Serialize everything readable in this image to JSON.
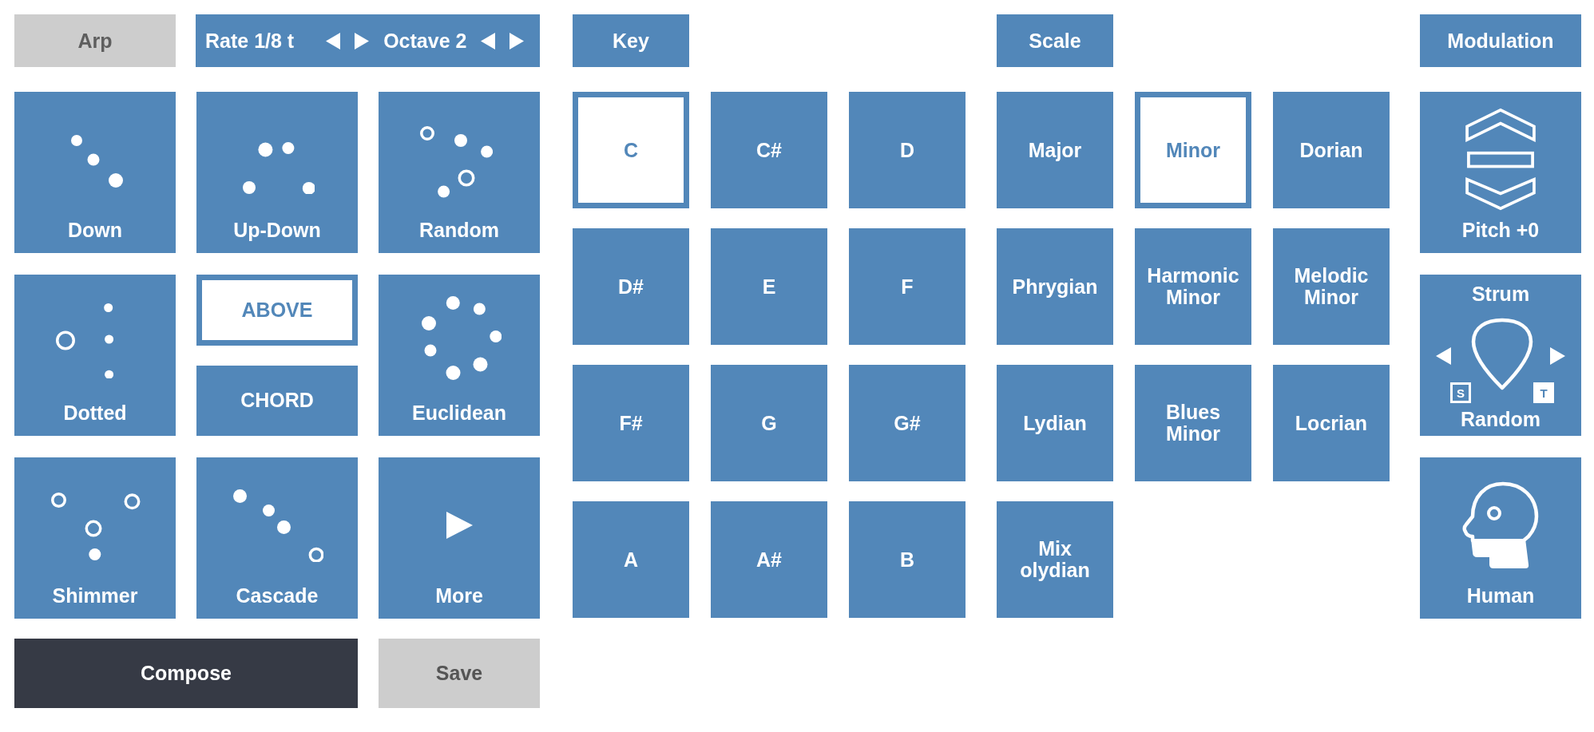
{
  "arp": {
    "toggle": {
      "label": "Arp",
      "on": false
    },
    "rate": {
      "label": "Rate 1/8 t"
    },
    "octave": {
      "label": "Octave 2"
    },
    "pads": [
      {
        "kind": "pattern",
        "label": "Down"
      },
      {
        "kind": "pattern",
        "label": "Up-Down"
      },
      {
        "kind": "pattern",
        "label": "Random"
      },
      {
        "kind": "pattern",
        "label": "Dotted"
      },
      {
        "kind": "pattern",
        "label": "Euclidean"
      },
      {
        "kind": "pattern",
        "label": "Shimmer"
      },
      {
        "kind": "pattern",
        "label": "Cascade"
      },
      {
        "kind": "more",
        "label": "More"
      }
    ],
    "voicing": [
      {
        "label": "ABOVE",
        "selected": true
      },
      {
        "label": "CHORD",
        "selected": false
      }
    ]
  },
  "key": {
    "header": "Key",
    "notes": [
      {
        "label": "C",
        "selected": true
      },
      {
        "label": "C#",
        "selected": false
      },
      {
        "label": "D",
        "selected": false
      },
      {
        "label": "D#",
        "selected": false
      },
      {
        "label": "E",
        "selected": false
      },
      {
        "label": "F",
        "selected": false
      },
      {
        "label": "F#",
        "selected": false
      },
      {
        "label": "G",
        "selected": false
      },
      {
        "label": "G#",
        "selected": false
      },
      {
        "label": "A",
        "selected": false
      },
      {
        "label": "A#",
        "selected": false
      },
      {
        "label": "B",
        "selected": false
      }
    ]
  },
  "scale": {
    "header": "Scale",
    "scales": [
      {
        "label": "Major",
        "selected": false
      },
      {
        "label": "Minor",
        "selected": true
      },
      {
        "label": "Dorian",
        "selected": false
      },
      {
        "label": "Phrygian",
        "selected": false
      },
      {
        "label": "Harmonic Minor",
        "selected": false
      },
      {
        "label": "Melodic Minor",
        "selected": false
      },
      {
        "label": "Lydian",
        "selected": false
      },
      {
        "label": "Blues Minor",
        "selected": false
      },
      {
        "label": "Locrian",
        "selected": false
      },
      {
        "label": "Mix olydian",
        "selected": false
      }
    ]
  },
  "modulation": {
    "header": "Modulation",
    "pads": [
      {
        "kind": "pitch",
        "label": "Pitch +0"
      },
      {
        "kind": "strum",
        "title": "Strum",
        "label": "Random",
        "toggles": [
          {
            "label": "S",
            "on": false
          },
          {
            "label": "T",
            "on": true
          }
        ]
      },
      {
        "kind": "human",
        "label": "Human"
      }
    ]
  },
  "actions": [
    {
      "kind": "primary",
      "label": "Compose"
    },
    {
      "kind": "secondary",
      "label": "Save"
    }
  ]
}
